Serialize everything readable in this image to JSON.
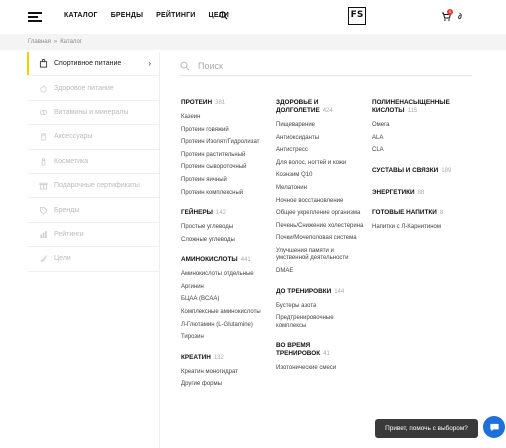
{
  "header": {
    "nav": [
      "КАТАЛОГ",
      "БРЕНДЫ",
      "РЕЙТИНГИ",
      "ЦЕЛИ"
    ],
    "logo": "FS",
    "cart_count": "0",
    "user_label": "∂"
  },
  "breadcrumb": {
    "home": "Главная",
    "separator": "»",
    "current": "Каталог"
  },
  "sidebar": {
    "items": [
      {
        "label": "Спортивное питание",
        "icon": "bag-icon",
        "active": true
      },
      {
        "label": "Здоровое питание",
        "icon": "apple-icon"
      },
      {
        "label": "Витамины и минералы",
        "icon": "pills-icon"
      },
      {
        "label": "Аксессуары",
        "icon": "shaker-icon"
      },
      {
        "label": "Косметика",
        "icon": "cosmetics-icon"
      },
      {
        "label": "Подарочные сертификаты",
        "icon": "gift-icon"
      },
      {
        "label": "Бренды",
        "icon": "tag-icon"
      },
      {
        "label": "Рейтинги",
        "icon": "chart-icon"
      },
      {
        "label": "Цели",
        "icon": "rocket-icon"
      }
    ]
  },
  "search": {
    "placeholder": "Поиск"
  },
  "columns": [
    [
      {
        "title": "Протеин",
        "count": "381",
        "items": [
          "Казеин",
          "Протеин говяжий",
          "Протеин Изолят/Гидролизат",
          "Протеин растительный",
          "Протеин сывороточный",
          "Протеин яичный",
          "Протеин комплексный"
        ]
      },
      {
        "title": "Гейнеры",
        "count": "142",
        "items": [
          "Простые углеводы",
          "Сложные углеводы"
        ]
      },
      {
        "title": "Аминокислоты",
        "count": "441",
        "items": [
          "Аминокислоты отдельные",
          "Аргинин",
          "БЦАА (BCAA)",
          "Комплексные аминокислоты",
          "Л-Глютамин (L-Glutamine)",
          "Тирозин"
        ]
      },
      {
        "title": "Креатин",
        "count": "132",
        "items": [
          "Креатин моногидрат",
          "Другие формы"
        ]
      }
    ],
    [
      {
        "title": "Здоровье и долголетие",
        "count": "424",
        "items": [
          "Пищеварение",
          "Антиоксиданты",
          "Антистресс",
          "Для волос, ногтей и кожи",
          "Коэнзим Q10",
          "Мелатонин",
          "Ночное восстановление",
          "Общее укрепление организма",
          "Печень/Снижение холестерина",
          "Почки/Мочеполовая система",
          "Улучшения памяти и умственной деятельности",
          "DMAE"
        ]
      },
      {
        "title": "До тренировки",
        "count": "144",
        "items": [
          "Бустеры азота",
          "Предтренировочные комплексы"
        ]
      },
      {
        "title": "Во время тренировок",
        "count": "41",
        "items": [
          "Изотонические смеси"
        ]
      }
    ],
    [
      {
        "title": "Полиненасыщенные кислоты",
        "count": "115",
        "items": [
          "Омега",
          "ALA",
          "CLA"
        ]
      },
      {
        "title": "Суставы и связки",
        "count": "189",
        "items": []
      },
      {
        "title": "Энергетики",
        "count": "88",
        "items": []
      },
      {
        "title": "Готовые напитки",
        "count": "8",
        "items": [
          "Напитки с Л-Карнитином"
        ]
      }
    ]
  ],
  "chat": {
    "text": "Привет, помочь с выбором?"
  },
  "colors": {
    "accent": "#f5d000",
    "badge": "#e53935",
    "chat_button": "#1e6fd9"
  }
}
